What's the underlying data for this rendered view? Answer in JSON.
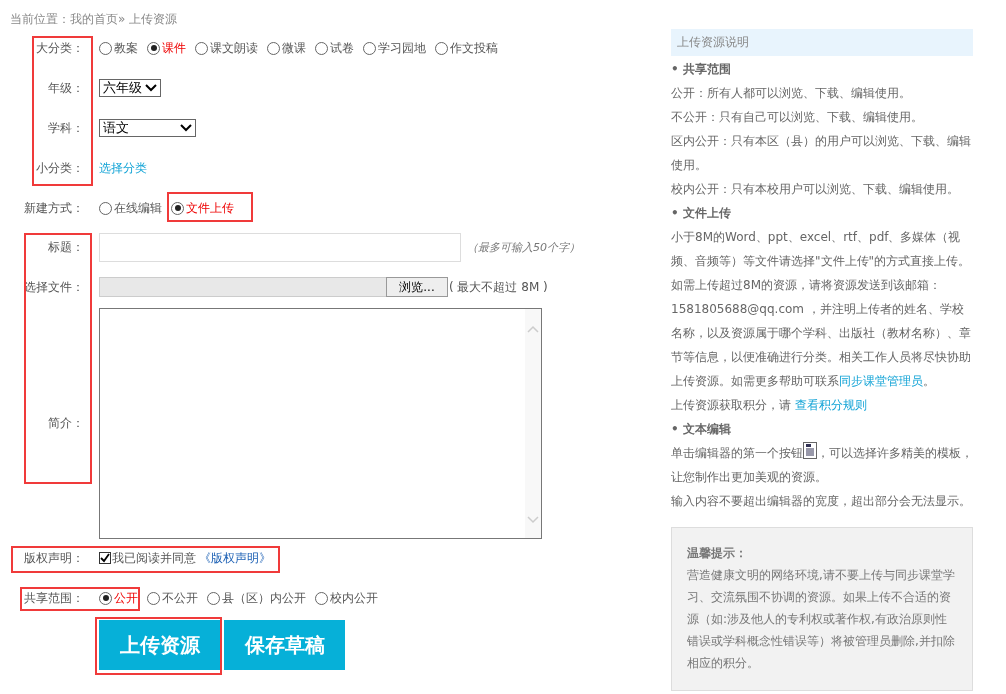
{
  "breadcrumb": "当前位置：我的首页» 上传资源",
  "category": {
    "label": "大分类：",
    "options": [
      {
        "label": "教案",
        "selected": false
      },
      {
        "label": "课件",
        "selected": true
      },
      {
        "label": "课文朗读",
        "selected": false
      },
      {
        "label": "微课",
        "selected": false
      },
      {
        "label": "试卷",
        "selected": false
      },
      {
        "label": "学习园地",
        "selected": false
      },
      {
        "label": "作文投稿",
        "selected": false
      }
    ]
  },
  "grade": {
    "label": "年级：",
    "value": "六年级"
  },
  "subject": {
    "label": "学科：",
    "value": "语文"
  },
  "subcategory": {
    "label": "小分类：",
    "link": "选择分类"
  },
  "create_mode": {
    "label": "新建方式：",
    "options": [
      {
        "label": "在线编辑",
        "selected": false
      },
      {
        "label": "文件上传",
        "selected": true
      }
    ]
  },
  "title": {
    "label": "标题：",
    "hint": "（最多可输入50个字）"
  },
  "file": {
    "label": "选择文件：",
    "button": "浏览...",
    "hint": "( 最大不超过 8M )"
  },
  "summary": {
    "label": "简介："
  },
  "copyright": {
    "label": "版权声明：",
    "checked": true,
    "text": "我已阅读并同意",
    "link": "《版权声明》"
  },
  "share": {
    "label": "共享范围：",
    "options": [
      {
        "label": "公开",
        "selected": true
      },
      {
        "label": "不公开",
        "selected": false
      },
      {
        "label": "县（区）内公开",
        "selected": false
      },
      {
        "label": "校内公开",
        "selected": false
      }
    ]
  },
  "buttons": [
    "上传资源",
    "保存草稿"
  ],
  "help": {
    "title": "上传资源说明",
    "items": [
      {
        "kind": "heading",
        "text": "• 共享范围"
      },
      {
        "kind": "para",
        "parts": [
          {
            "kind": "text",
            "text": "公开：所有人都可以浏览、下载、编辑使用。"
          }
        ]
      },
      {
        "kind": "para",
        "parts": [
          {
            "kind": "text",
            "text": "不公开：只有自己可以浏览、下载、编辑使用。"
          }
        ]
      },
      {
        "kind": "para",
        "parts": [
          {
            "kind": "text",
            "text": "区内公开：只有本区（县）的用户可以浏览、下载、编辑使用。"
          }
        ]
      },
      {
        "kind": "para",
        "parts": [
          {
            "kind": "text",
            "text": "校内公开：只有本校用户可以浏览、下载、编辑使用。"
          }
        ]
      },
      {
        "kind": "heading",
        "text": "• 文件上传"
      },
      {
        "kind": "para",
        "parts": [
          {
            "kind": "text",
            "text": "小于8M的Word、ppt、excel、rtf、pdf、多媒体（视频、音频等）等文件请选择\"文件上传\"的方式直接上传。"
          }
        ]
      },
      {
        "kind": "para",
        "parts": [
          {
            "kind": "text",
            "text": "如需上传超过8M的资源，请将资源发送到该邮箱：1581805688@qq.com ，并注明上传者的姓名、学校名称，以及资源属于哪个学科、出版社（教材名称）、章节等信息，以便准确进行分类。相关工作人员将尽快协助上传资源。如需更多帮助可联系"
          },
          {
            "kind": "link",
            "text": "同步课堂管理员"
          },
          {
            "kind": "text",
            "text": "。"
          }
        ]
      },
      {
        "kind": "para",
        "parts": [
          {
            "kind": "text",
            "text": "上传资源获取积分，请 "
          },
          {
            "kind": "link",
            "text": "查看积分规则"
          }
        ]
      },
      {
        "kind": "heading",
        "text": "• 文本编辑"
      },
      {
        "kind": "para",
        "parts": [
          {
            "kind": "text",
            "text": "单击编辑器的第一个按钮"
          },
          {
            "kind": "icon"
          },
          {
            "kind": "text",
            "text": "，可以选择许多精美的模板，让您制作出更加美观的资源。"
          }
        ]
      },
      {
        "kind": "para",
        "parts": [
          {
            "kind": "text",
            "text": "输入内容不要超出编辑器的宽度，超出部分会无法显示。"
          }
        ]
      }
    ]
  },
  "tips": {
    "title": "温馨提示：",
    "text": "营造健康文明的网络环境,请不要上传与同步课堂学习、交流氛围不协调的资源。如果上传不合适的资源（如:涉及他人的专利权或著作权,有政治原则性错误或学科概念性错误等）将被管理员删除,并扣除相应的积分。"
  }
}
